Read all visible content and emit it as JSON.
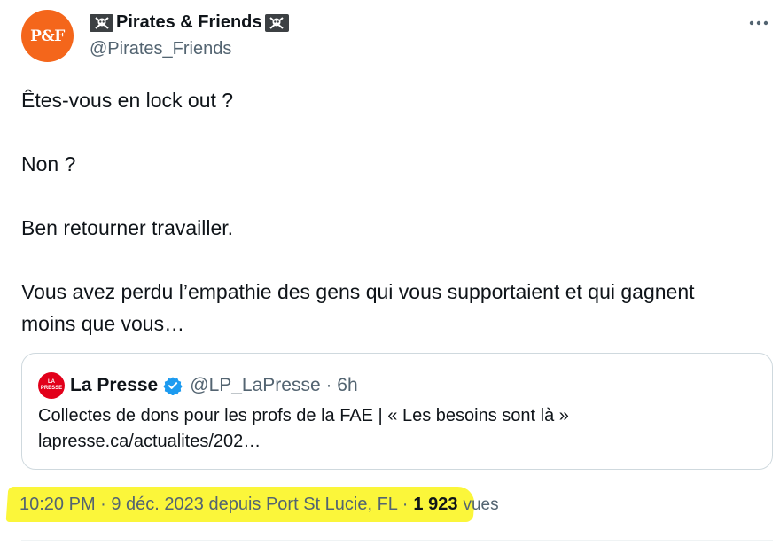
{
  "author": {
    "avatar_text": "P&F",
    "display_name": "Pirates & Friends",
    "handle": "@Pirates_Friends",
    "name_emoji": "skull-and-crossbones"
  },
  "tweet": {
    "lines": [
      "Êtes-vous en lock out ?",
      "Non ?",
      "Ben retourner travailler.",
      "Vous avez perdu l’empathie des gens qui vous supportaient et qui gagnent moins que vous…"
    ]
  },
  "quote": {
    "logo_top": "LA",
    "logo_bottom": "PRESSE",
    "name": "La Presse",
    "handle_time": "@LP_LaPresse · 6h",
    "text_line1": "Collectes de dons pour les profs de la FAE | « Les besoins sont là »",
    "text_line2": "lapresse.ca/actualites/202…",
    "verified_color": "#1d9bf0",
    "logo_color": "#e2001a"
  },
  "meta": {
    "timestamp": "10:20 PM · 9 déc. 2023 depuis Port St Lucie, FL ·",
    "views_count": "1 923",
    "views_label": "vues",
    "highlight_color": "#fbf63a"
  },
  "colors": {
    "avatar_bg": "#f4661b",
    "text_primary": "#0f1419",
    "text_secondary": "#536471",
    "border": "#cfd9de"
  },
  "icons": {
    "more": "more-horizontal-icon",
    "verified": "verified-badge-icon"
  }
}
